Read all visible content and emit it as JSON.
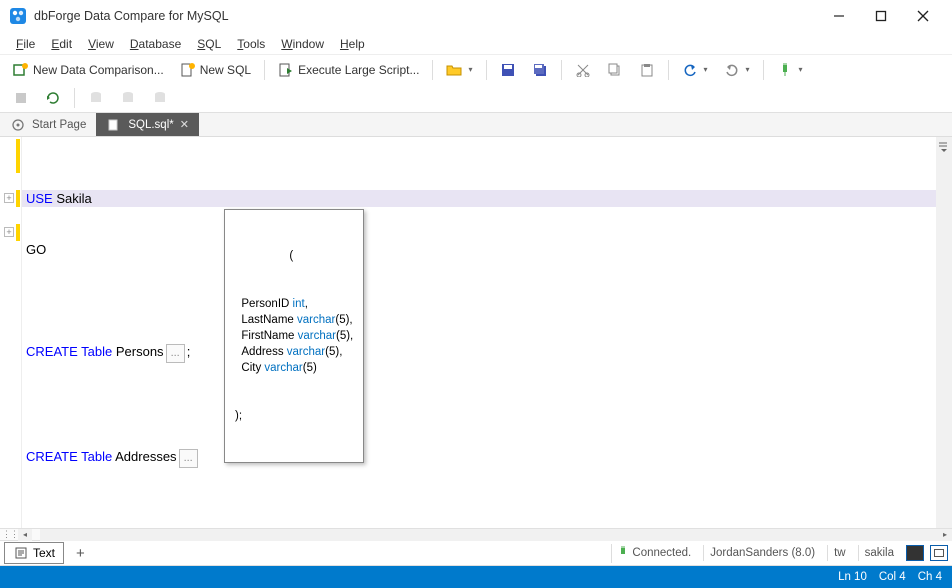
{
  "window": {
    "title": "dbForge Data Compare for MySQL"
  },
  "menu": {
    "file": "File",
    "edit": "Edit",
    "view": "View",
    "database": "Database",
    "sql": "SQL",
    "tools": "Tools",
    "window": "Window",
    "help": "Help"
  },
  "toolbar": {
    "new_data_comparison": "New Data Comparison...",
    "new_sql": "New SQL",
    "execute_large_script": "Execute Large Script..."
  },
  "tabs": {
    "start_page": "Start Page",
    "sql_file": "SQL.sql*"
  },
  "editor": {
    "lines": [
      {
        "kw": "USE",
        "rest": " Sakila"
      },
      {
        "kw": "",
        "rest": "GO"
      }
    ],
    "create1_kw": "CREATE",
    "create1_kw2": "Table",
    "create1_name": "Persons",
    "create1_collapsed": "...",
    "create1_end": ";",
    "create2_kw": "CREATE",
    "create2_kw2": "Table",
    "create2_name": "Addresses",
    "create2_collapsed": "..."
  },
  "tooltip": {
    "open": "(",
    "rows": [
      {
        "name": "PersonID",
        "type": "int",
        "trail": ","
      },
      {
        "name": "LastName",
        "type": "varchar",
        "size": "5",
        "trail": ","
      },
      {
        "name": "FirstName",
        "type": "varchar",
        "size": "5",
        "trail": ","
      },
      {
        "name": "Address",
        "type": "varchar",
        "size": "5",
        "trail": ","
      },
      {
        "name": "City",
        "type": "varchar",
        "size": "5",
        "trail": ""
      }
    ],
    "close": ");"
  },
  "bottom": {
    "text_tab": "Text",
    "connected": "Connected.",
    "user": "JordanSanders (8.0)",
    "tw": "tw",
    "db": "sakila"
  },
  "status": {
    "ln": "Ln 10",
    "col": "Col 4",
    "ch": "Ch 4"
  }
}
